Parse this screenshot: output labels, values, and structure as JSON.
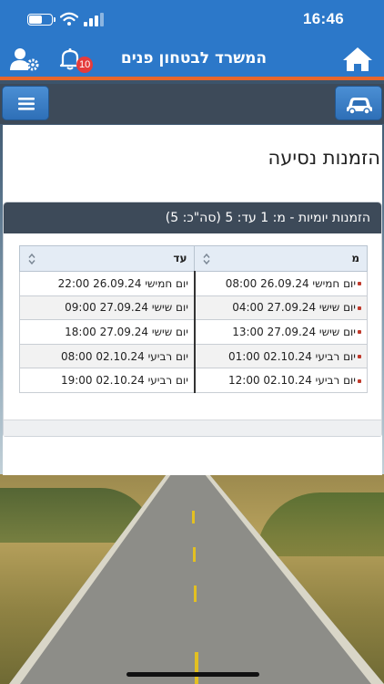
{
  "status_bar": {
    "time": "16:46"
  },
  "header": {
    "title": "המשרד לבטחון פנים",
    "notification_count": "10",
    "icons": {
      "home": "home-icon",
      "notifications": "bell-icon",
      "user_settings": "user-gear-icon"
    }
  },
  "toolbar": {
    "icons": {
      "menu": "hamburger-menu-icon",
      "vehicle": "car-icon"
    }
  },
  "page": {
    "title": "הזמנות נסיעה"
  },
  "card": {
    "header": "הזמנות יומיות - מ: 1 עד: 5 (סה\"כ: 5)",
    "columns": {
      "from": "מ",
      "to": "עד"
    },
    "rows": [
      {
        "from": "יום חמישי 26.09.24 08:00",
        "to": "יום חמישי 26.09.24 22:00"
      },
      {
        "from": "יום שישי 27.09.24 04:00",
        "to": "יום שישי 27.09.24 09:00"
      },
      {
        "from": "יום שישי 27.09.24 13:00",
        "to": "יום שישי 27.09.24 18:00"
      },
      {
        "from": "יום רביעי 02.10.24 01:00",
        "to": "יום רביעי 02.10.24 08:00"
      },
      {
        "from": "יום רביעי 02.10.24 12:00",
        "to": "יום רביעי 02.10.24 19:00"
      }
    ]
  },
  "colors": {
    "header_blue": "#2c78c9",
    "accent_orange": "#e8662b",
    "toolbar_dark": "#3d4a59",
    "badge_red": "#e53b3b"
  }
}
